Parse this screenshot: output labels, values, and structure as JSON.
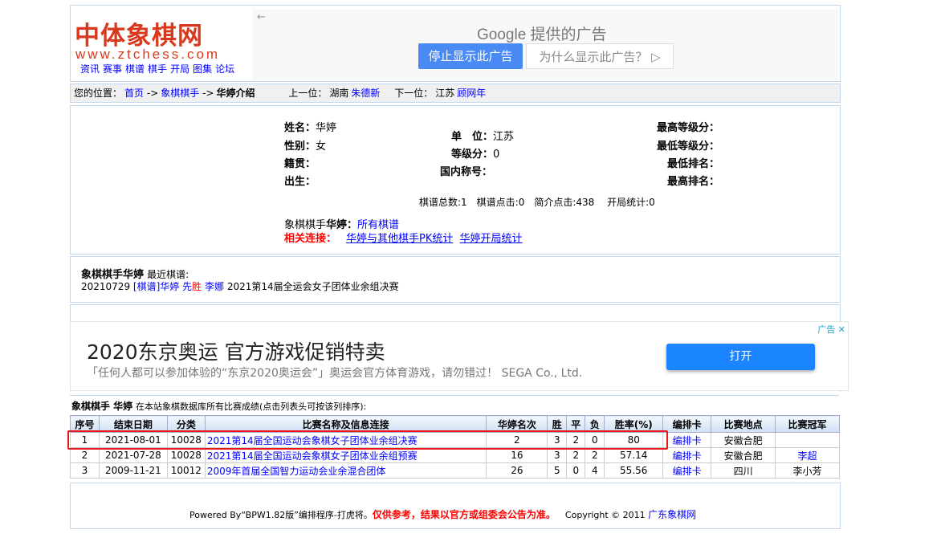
{
  "header": {
    "logo_cn": "中体象棋网",
    "logo_url": "www.ztchess.com",
    "nav": [
      "资讯",
      "赛事",
      "棋谱",
      "棋手",
      "开局",
      "图集",
      "论坛"
    ],
    "ad": {
      "back": "←",
      "provider": "Google 提供的广告",
      "stop": "停止显示此广告",
      "why": "为什么显示此广告？ ▷"
    }
  },
  "breadcrumb": {
    "label": "您的位置：",
    "home": "首页",
    "sep": "->",
    "section": "象棋棋手",
    "current": "华婷介绍",
    "prev_label": "上一位：",
    "prev_region": "湖南",
    "prev_name": "朱德新",
    "next_label": "下一位：",
    "next_region": "江苏",
    "next_name": "顾网年"
  },
  "profile": {
    "name_label": "姓名：",
    "name": "华婷",
    "gender_label": "性别：",
    "gender": "女",
    "origin_label": "籍贯：",
    "birth_label": "出生：",
    "unit_label": "单　位：",
    "unit": "江苏",
    "grade_label": "等级分：",
    "grade": "0",
    "title_label": "国内称号：",
    "max_grade_label": "最高等级分：",
    "min_grade_label": "最低等级分：",
    "min_rank_label": "最低排名：",
    "max_rank_label": "最高排名：",
    "stats": "棋谱总数:1　棋谱点击:0　简介点击:438　 开局统计:0",
    "all_games_prefix": "象棋棋手",
    "all_games_name": "华婷",
    "all_games_colon": "：",
    "all_games": "所有棋谱",
    "related_label": "相关连接：",
    "link_pk": "华婷与其他棋手PK统计",
    "link_opening": "华婷开局统计"
  },
  "recent": {
    "title": "象棋棋手华婷",
    "subtitle": "最近棋谱:",
    "date": "20210729",
    "game": "[棋谱]华婷",
    "result_a": "先",
    "result_b": "胜",
    "opponent": "李娜",
    "event": "2021第14届全运会女子团体业余组决赛"
  },
  "ad2": {
    "title": "2020东京奥运 官方游戏促销特卖",
    "sub": "「任何人都可以参加体验的“东京2020奥运会”」奥运会官方体育游戏，请勿错过！ SEGA Co., Ltd.",
    "button": "打开",
    "label": "广告 ✕"
  },
  "results": {
    "caption_a": "象棋棋手 华婷",
    "caption_b": "在本站象棋数据库所有比赛成绩(点击列表头可按该列排序):",
    "headers": [
      "序号",
      "结束日期",
      "分类",
      "比赛名称及信息连接",
      "华婷名次",
      "胜",
      "平",
      "负",
      "胜率(%)",
      "编排卡",
      "比赛地点",
      "比赛冠军"
    ],
    "rows": [
      [
        "1",
        "2021-08-01",
        "10028",
        "2021第14届全国运动会象棋女子团体业余组决赛",
        "2",
        "3",
        "2",
        "0",
        "80",
        "编排卡",
        "安徽合肥",
        ""
      ],
      [
        "2",
        "2021-07-28",
        "10028",
        "2021第14届全国运动会象棋女子团体业余组预赛",
        "16",
        "3",
        "2",
        "2",
        "57.14",
        "编排卡",
        "安徽合肥",
        "李超"
      ],
      [
        "3",
        "2009-11-21",
        "10012",
        "2009年首届全国智力运动会业余混合团体",
        "26",
        "5",
        "0",
        "4",
        "55.56",
        "编排卡",
        "四川",
        "李小芳"
      ]
    ]
  },
  "footer": {
    "powered": "Powered By“BPW1.82版”编排程序-打虎将。",
    "notice": "仅供参考，结果以官方或组委会公告为准。",
    "copyright": "Copyright © 2011",
    "site": "广东象棋网"
  }
}
